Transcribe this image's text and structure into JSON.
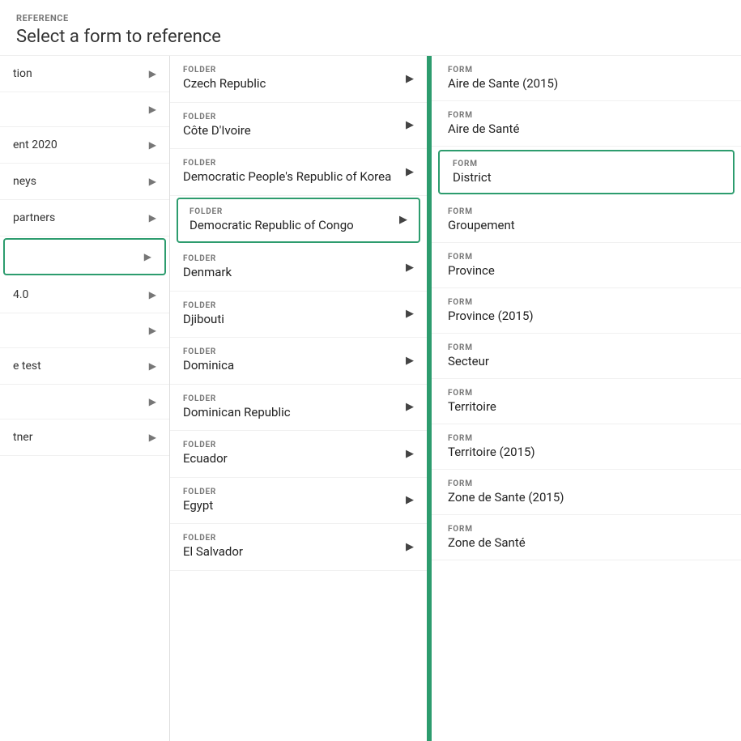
{
  "header": {
    "reference_label": "REFERENCE",
    "title": "Select a form to reference"
  },
  "left_sidebar": {
    "items": [
      {
        "id": "item1",
        "text": "tion",
        "active": false
      },
      {
        "id": "item2",
        "text": "",
        "active": false
      },
      {
        "id": "item3",
        "text": "ent 2020",
        "active": false
      },
      {
        "id": "item4",
        "text": "neys",
        "active": false
      },
      {
        "id": "item5",
        "text": "partners",
        "active": false
      },
      {
        "id": "item6",
        "text": "",
        "active": true
      },
      {
        "id": "item7",
        "text": "4.0",
        "active": false
      },
      {
        "id": "item8",
        "text": "",
        "active": false
      },
      {
        "id": "item9",
        "text": "e test",
        "active": false
      },
      {
        "id": "item10",
        "text": "",
        "active": false
      },
      {
        "id": "item11",
        "text": "tner",
        "active": false
      }
    ]
  },
  "middle_column": {
    "folders": [
      {
        "id": "czech",
        "type": "FOLDER",
        "name": "Czech Republic",
        "selected": false
      },
      {
        "id": "cote",
        "type": "FOLDER",
        "name": "Côte D'Ivoire",
        "selected": false
      },
      {
        "id": "dprk",
        "type": "FOLDER",
        "name": "Democratic People's Republic of Korea",
        "selected": false
      },
      {
        "id": "drc",
        "type": "FOLDER",
        "name": "Democratic Republic of Congo",
        "selected": true
      },
      {
        "id": "denmark",
        "type": "FOLDER",
        "name": "Denmark",
        "selected": false
      },
      {
        "id": "djibouti",
        "type": "FOLDER",
        "name": "Djibouti",
        "selected": false
      },
      {
        "id": "dominica",
        "type": "FOLDER",
        "name": "Dominica",
        "selected": false
      },
      {
        "id": "dominican",
        "type": "FOLDER",
        "name": "Dominican Republic",
        "selected": false
      },
      {
        "id": "ecuador",
        "type": "FOLDER",
        "name": "Ecuador",
        "selected": false
      },
      {
        "id": "egypt",
        "type": "FOLDER",
        "name": "Egypt",
        "selected": false
      },
      {
        "id": "el_salvador",
        "type": "FOLDER",
        "name": "El Salvador",
        "selected": false
      }
    ]
  },
  "right_column": {
    "forms": [
      {
        "id": "aire2015",
        "type": "FORM",
        "name": "Aire de Sante (2015)",
        "selected": false
      },
      {
        "id": "aire",
        "type": "FORM",
        "name": "Aire de Santé",
        "selected": false
      },
      {
        "id": "district",
        "type": "FORM",
        "name": "District",
        "selected": true
      },
      {
        "id": "groupement",
        "type": "FORM",
        "name": "Groupement",
        "selected": false
      },
      {
        "id": "province",
        "type": "FORM",
        "name": "Province",
        "selected": false
      },
      {
        "id": "province2015",
        "type": "FORM",
        "name": "Province (2015)",
        "selected": false
      },
      {
        "id": "secteur",
        "type": "FORM",
        "name": "Secteur",
        "selected": false
      },
      {
        "id": "territoire",
        "type": "FORM",
        "name": "Territoire",
        "selected": false
      },
      {
        "id": "territoire2015",
        "type": "FORM",
        "name": "Territoire (2015)",
        "selected": false
      },
      {
        "id": "zone2015",
        "type": "FORM",
        "name": "Zone de Sante (2015)",
        "selected": false
      },
      {
        "id": "zone",
        "type": "FORM",
        "name": "Zone de Santé",
        "selected": false
      }
    ]
  },
  "icons": {
    "arrow_right": "▶"
  }
}
